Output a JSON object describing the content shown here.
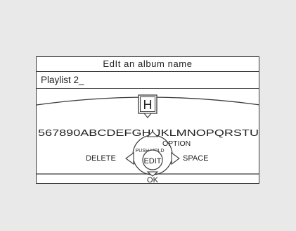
{
  "dialog": {
    "title": "EdIt an album name",
    "entry_text": "Playlist 2_"
  },
  "dial": {
    "selected_char": "H",
    "character_row": "567890ABCDEFGHIJKLMNOPQRSTU",
    "delete_label": "DELETE",
    "space_label": "SPACE",
    "option_label": "OPTION",
    "push_hold_label": "PUSH HOLD",
    "edit_label": "EDIT",
    "ok_label": "OK"
  },
  "icons": {
    "up": "triangle-up-icon",
    "down": "triangle-down-icon",
    "left": "triangle-left-icon",
    "right": "triangle-right-icon"
  }
}
